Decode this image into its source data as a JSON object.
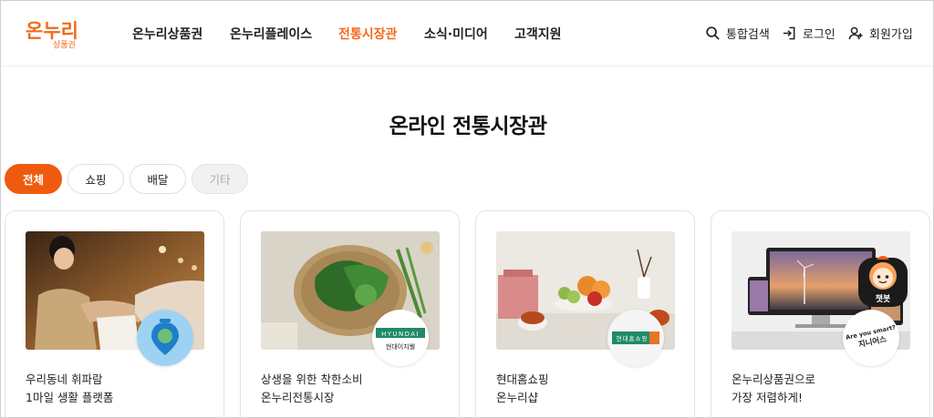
{
  "brand": {
    "logo_main": "온누리",
    "logo_sub": "상품권",
    "color": "#f26a1b"
  },
  "nav": [
    {
      "label": "온누리상품권"
    },
    {
      "label": "온누리플레이스"
    },
    {
      "label": "전통시장관",
      "active": true
    },
    {
      "label": "소식·미디어"
    },
    {
      "label": "고객지원"
    }
  ],
  "utility": [
    {
      "label": "통합검색",
      "icon": "search-icon"
    },
    {
      "label": "로그인",
      "icon": "login-icon"
    },
    {
      "label": "회원가입",
      "icon": "user-plus-icon"
    }
  ],
  "page_title": "온라인 전통시장관",
  "filters": [
    {
      "label": "전체",
      "active": true
    },
    {
      "label": "쇼핑"
    },
    {
      "label": "배달"
    },
    {
      "label": "기타",
      "disabled": true
    }
  ],
  "cards": [
    {
      "line1": "우리동네 휘파람",
      "line2": "1마일 생활 플랫폼",
      "badge": ""
    },
    {
      "line1": "상생을 위한 착한소비",
      "line2": "온누리전통시장",
      "badge": "HYUNDAI",
      "badge_sub": "현대이지웰"
    },
    {
      "line1": "현대홈쇼핑",
      "line2": "온누리샵",
      "badge": "현대홈쇼핑"
    },
    {
      "line1": "온누리상품권으로",
      "line2": "가장 저렴하게!",
      "badge": "Are you smart?",
      "badge_sub": "지니어스"
    }
  ],
  "chatbot": {
    "label": "챗봇",
    "icon": "chatbot-icon"
  },
  "colors": {
    "accent": "#f05a0f",
    "border": "#e3e3e3",
    "text": "#222222"
  }
}
